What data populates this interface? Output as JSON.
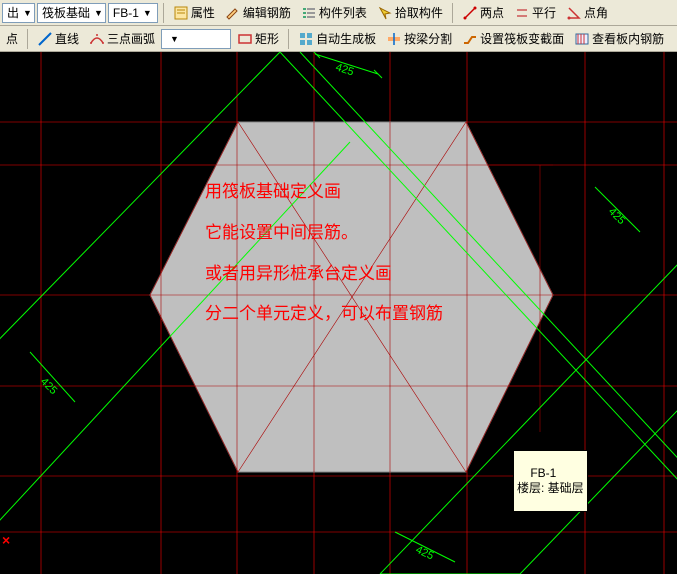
{
  "toolbar1": {
    "combo_partial": "出",
    "combo_type": "筏板基础",
    "combo_id": "FB-1",
    "attr": "属性",
    "edit_rebar": "编辑钢筋",
    "component_list": "构件列表",
    "pick_component": "拾取构件",
    "two_point": "两点",
    "parallel": "平行",
    "point_angle": "点角",
    "partial_right": ""
  },
  "toolbar2": {
    "point": "点",
    "line": "直线",
    "arc3": "三点画弧",
    "rect": "矩形",
    "auto_gen": "自动生成板",
    "beam_split": "按梁分割",
    "set_raft_section": "设置筏板变截面",
    "view_plate_rebar": "查看板内钢筋"
  },
  "canvas": {
    "dims": [
      "425",
      "425",
      "425",
      "425"
    ],
    "tooltip": "FB-1\n楼层: 基础层",
    "annotation_lines": [
      "用筏板基础定义画",
      "它能设置中间层筋。",
      "或者用异形桩承台定义画",
      "分二个单元定义，可以布置钢筋"
    ],
    "origin_mark": "×"
  }
}
